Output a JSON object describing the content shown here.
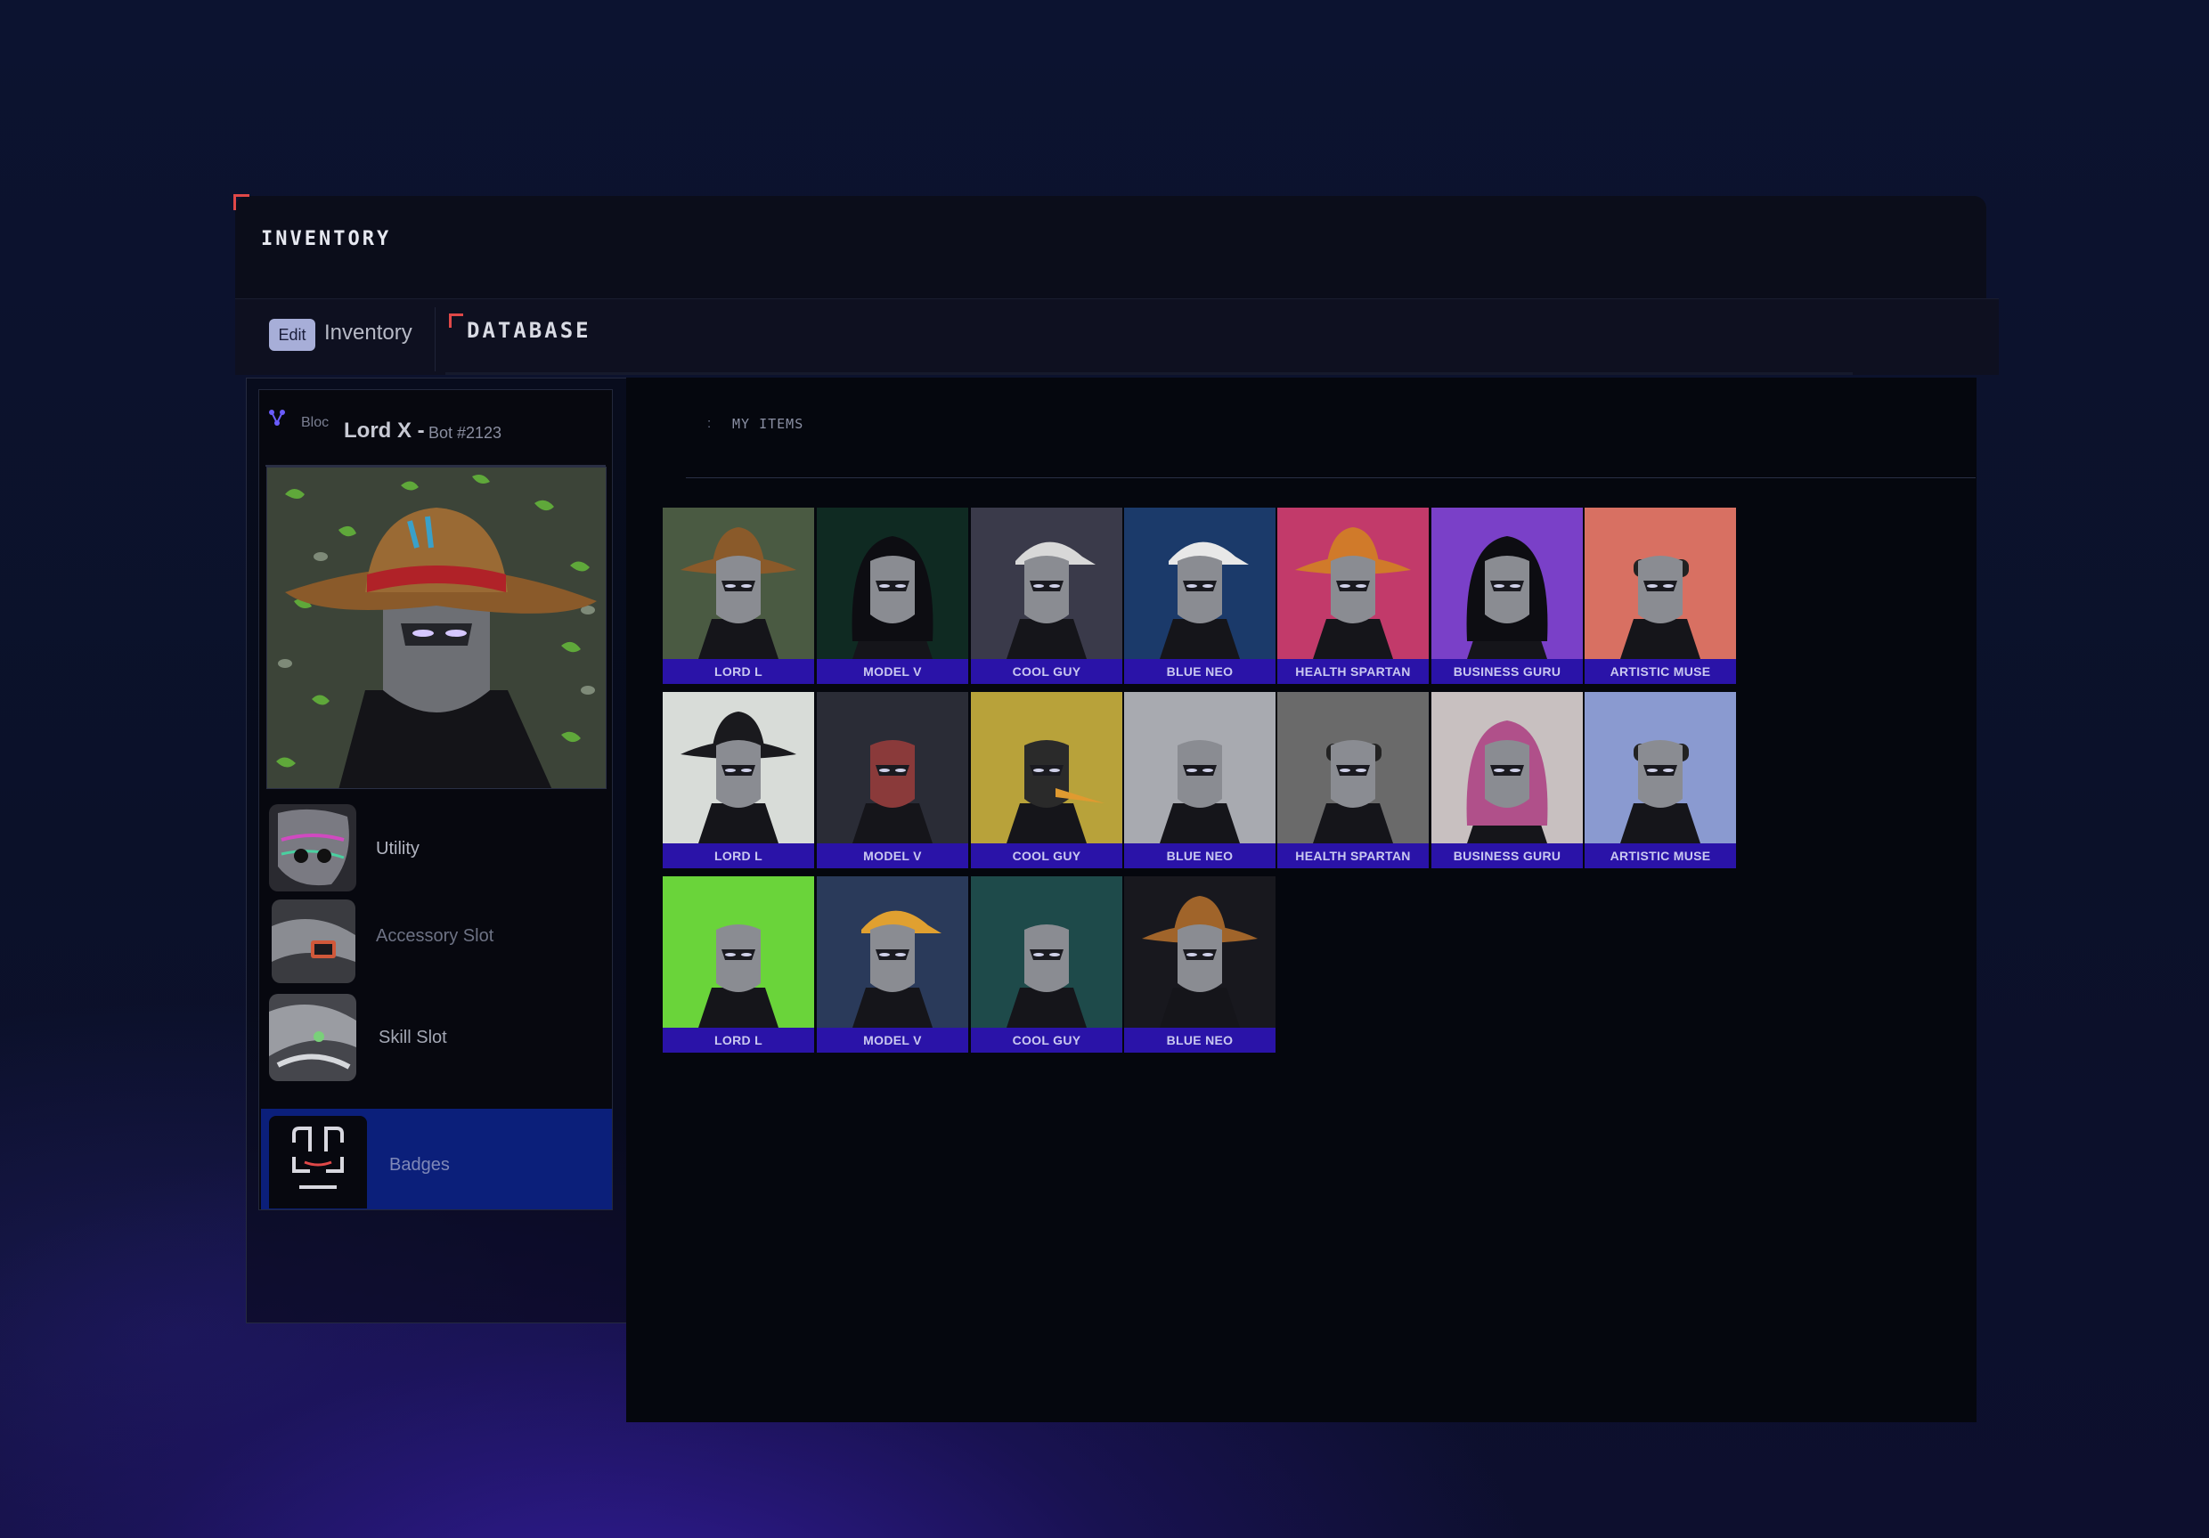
{
  "window": {
    "title": "INVENTORY"
  },
  "tabs": {
    "edit_label": "Edit",
    "inventory_label": "Inventory",
    "database_label": "DATABASE"
  },
  "section": {
    "title": "MY ITEMS",
    "dot": ":"
  },
  "bot": {
    "bloc": "Bloc",
    "name": "Lord X -",
    "id": "Bot #2123"
  },
  "slots": [
    {
      "label": "Utility"
    },
    {
      "label": "Accessory Slot"
    },
    {
      "label": "Skill Slot"
    },
    {
      "label": "Badges"
    }
  ],
  "colors": {
    "accent_red": "#e04848",
    "label_bar": "#2a13a8",
    "badges_bar": "#0b1f7a",
    "edit_button": "#a7aed8"
  },
  "items": [
    {
      "name": "LORD L",
      "bg": "#4a5a42",
      "helmet": "hat-brown"
    },
    {
      "name": "MODEL V",
      "bg": "#0f2a22",
      "helmet": "hood"
    },
    {
      "name": "COOL GUY",
      "bg": "#3a3a4a",
      "helmet": "cap"
    },
    {
      "name": "BLUE NEO",
      "bg": "#1b3a6a",
      "helmet": "trucker"
    },
    {
      "name": "HEALTH SPARTAN",
      "bg": "#c23a6a",
      "helmet": "hat-orange"
    },
    {
      "name": "BUSINESS GURU",
      "bg": "#7a40c8",
      "helmet": "bucket"
    },
    {
      "name": "ARTISTIC MUSE",
      "bg": "#d87062",
      "helmet": "goggles"
    },
    {
      "name": "LORD L",
      "bg": "#d8dcd8",
      "helmet": "cowboy"
    },
    {
      "name": "MODEL V",
      "bg": "#2a2c36",
      "helmet": "skull"
    },
    {
      "name": "COOL GUY",
      "bg": "#b8a23a",
      "helmet": "beak"
    },
    {
      "name": "BLUE NEO",
      "bg": "#a8aab0",
      "helmet": "band"
    },
    {
      "name": "HEALTH SPARTAN",
      "bg": "#6a6a6a",
      "helmet": "army"
    },
    {
      "name": "BUSINESS GURU",
      "bg": "#c8c0c0",
      "helmet": "hoodie"
    },
    {
      "name": "ARTISTIC MUSE",
      "bg": "#8a9ad0",
      "helmet": "cyber"
    },
    {
      "name": "LORD L",
      "bg": "#6ad43a",
      "helmet": "skeleton"
    },
    {
      "name": "MODEL V",
      "bg": "#2a3a5a",
      "helmet": "propeller"
    },
    {
      "name": "COOL GUY",
      "bg": "#1e4a4a",
      "helmet": "monkey"
    },
    {
      "name": "BLUE NEO",
      "bg": "#18181e",
      "helmet": "conical"
    }
  ]
}
